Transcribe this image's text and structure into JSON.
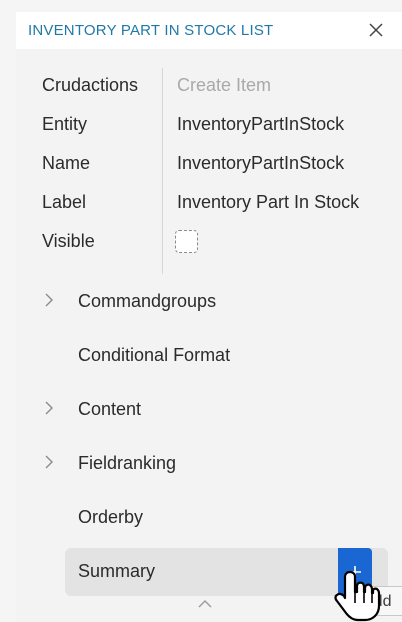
{
  "header": {
    "title": "INVENTORY PART IN STOCK LIST",
    "close_icon": "close-icon"
  },
  "properties": [
    {
      "label": "Crudactions",
      "value": "Create Item",
      "placeholder": true
    },
    {
      "label": "Entity",
      "value": "InventoryPartInStock",
      "placeholder": false
    },
    {
      "label": "Name",
      "value": "InventoryPartInStock",
      "placeholder": false
    },
    {
      "label": "Label",
      "value": "Inventory Part In Stock",
      "placeholder": false
    },
    {
      "label": "Visible",
      "checked": false
    }
  ],
  "tree": {
    "items": [
      {
        "label": "Commandgroups",
        "expandable": true
      },
      {
        "label": "Conditional Format",
        "expandable": false
      },
      {
        "label": "Content",
        "expandable": true
      },
      {
        "label": "Fieldranking",
        "expandable": true
      },
      {
        "label": "Orderby",
        "expandable": false
      },
      {
        "label": "Summary",
        "expandable": false,
        "selected": true
      }
    ]
  },
  "add_button": {
    "icon": "plus-icon"
  },
  "tooltip": {
    "text": "Add"
  },
  "colors": {
    "accent": "#1f78a8",
    "button": "#1a66d2",
    "selected_bg": "#e3e3e3"
  }
}
